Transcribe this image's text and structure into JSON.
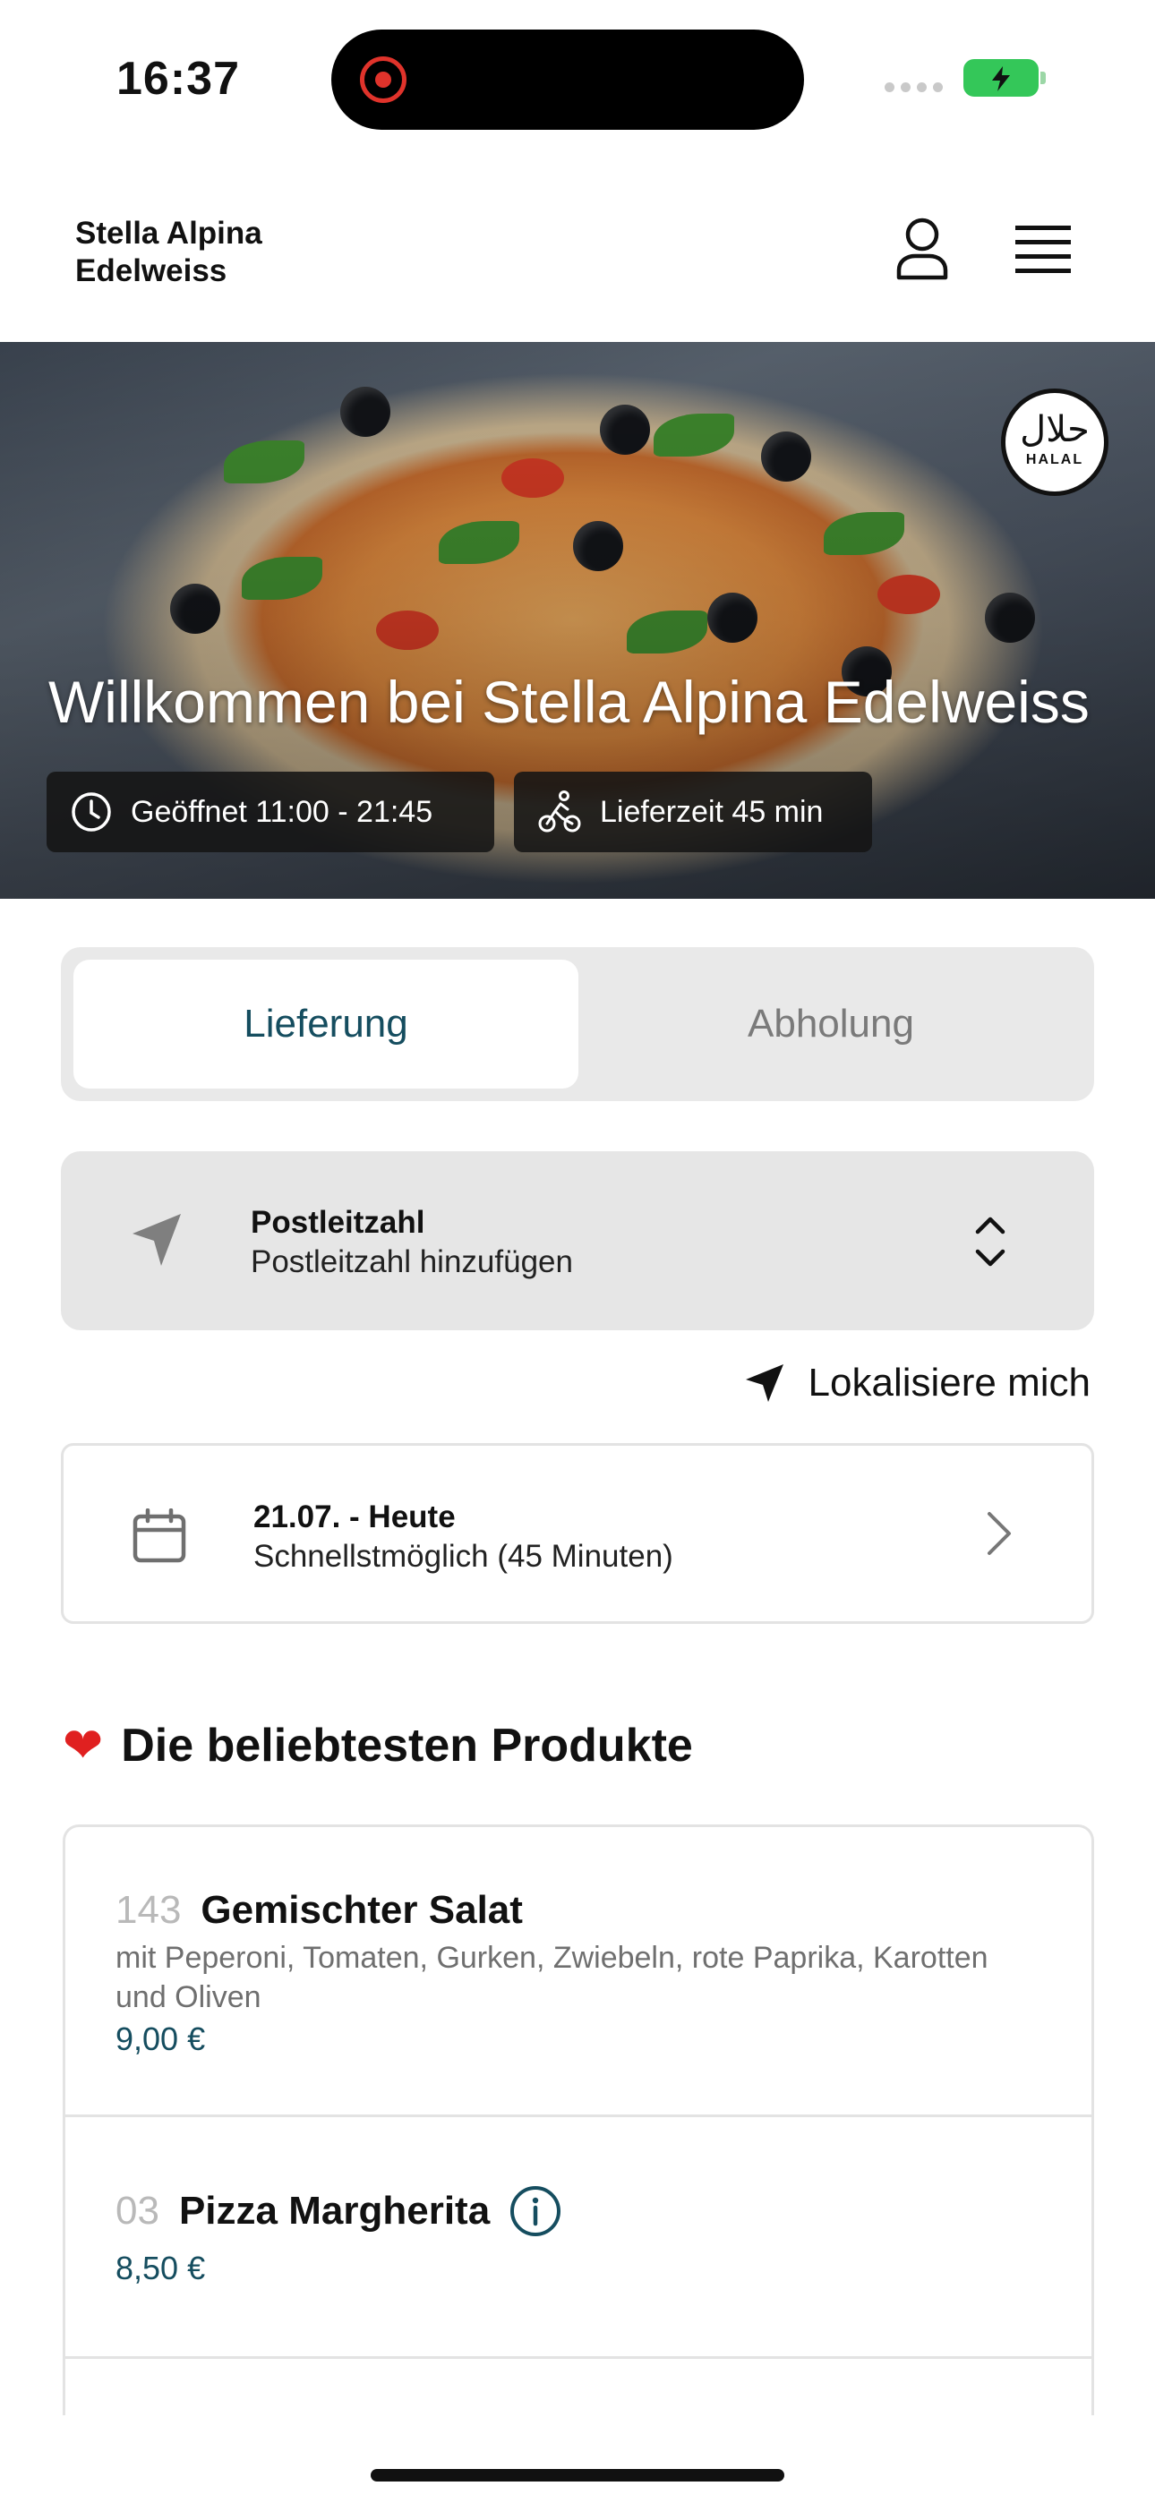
{
  "status_bar": {
    "time": "16:37"
  },
  "header": {
    "brand_line1": "Stella Alpina",
    "brand_line2": "Edelweiss",
    "icons": [
      "user-icon",
      "menu-icon"
    ]
  },
  "hero": {
    "badge_arabic": "حلال",
    "badge_text": "HALAL",
    "title": "Willkommen bei Stella Alpina Edelweiss",
    "hours_chip": "Geöffnet 11:00 - 21:45",
    "delivery_chip": "Lieferzeit 45 min"
  },
  "order_mode": {
    "options": [
      "Lieferung",
      "Abholung"
    ],
    "selected": "Lieferung"
  },
  "postcode": {
    "label": "Postleitzahl",
    "value": "Postleitzahl hinzufügen"
  },
  "locate": {
    "label": "Lokalisiere mich"
  },
  "schedule": {
    "title": "21.07. - Heute",
    "subtitle": "Schnellstmöglich (45 Minuten)"
  },
  "popular": {
    "heading": "Die beliebtesten Produkte",
    "products": [
      {
        "number": "143",
        "name": "Gemischter Salat",
        "description": "mit Peperoni, Tomaten, Gurken, Zwiebeln, rote Paprika, Karotten und Oliven",
        "price": "9,00 €"
      },
      {
        "number": "03",
        "name": "Pizza Margherita",
        "price": "8,50 €"
      }
    ]
  },
  "colors": {
    "accent": "#154d5f",
    "record": "#e0332b",
    "battery": "#34c759",
    "heart": "#e02020"
  }
}
